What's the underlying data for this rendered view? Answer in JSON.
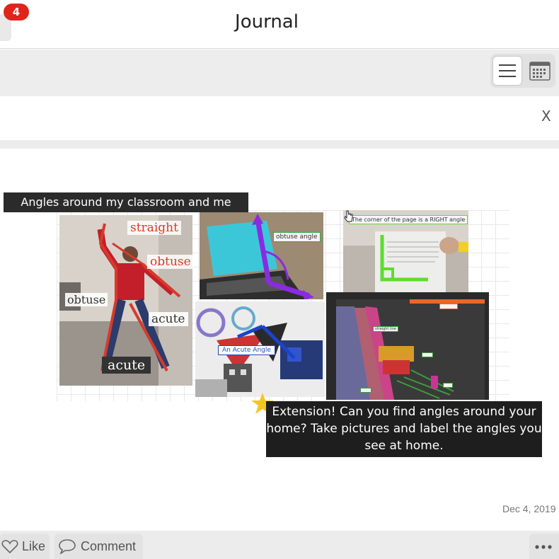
{
  "header": {
    "title": "Journal",
    "notification_count": "4"
  },
  "toolbar": {
    "list_view": "list-icon",
    "calendar_view": "calendar-icon"
  },
  "close_label": "X",
  "post": {
    "top_caption": "Angles around my classroom and me",
    "photo_person_labels": {
      "straight": "straight",
      "obtuse_right": "obtuse",
      "obtuse_left": "obtuse",
      "acute_right": "acute",
      "acute_bottom": "acute"
    },
    "photo_laptop_label": "obtuse angle",
    "photo_paper_label": "The corner of the page is a RIGHT angle",
    "photo_art_label": "An Acute Angle",
    "photo_shelf_labels": [
      "straight line"
    ],
    "extension_text": "Extension! Can you find angles around your home? Take pictures and label the angles you see at home.",
    "date": "Dec 4, 2019"
  },
  "footer": {
    "like_label": "Like",
    "comment_label": "Comment"
  },
  "colors": {
    "badge": "#e0241b",
    "person_outline": "#d83a2a",
    "laptop_arrow": "#8a2be2",
    "right_angle": "#5fdc2e"
  }
}
